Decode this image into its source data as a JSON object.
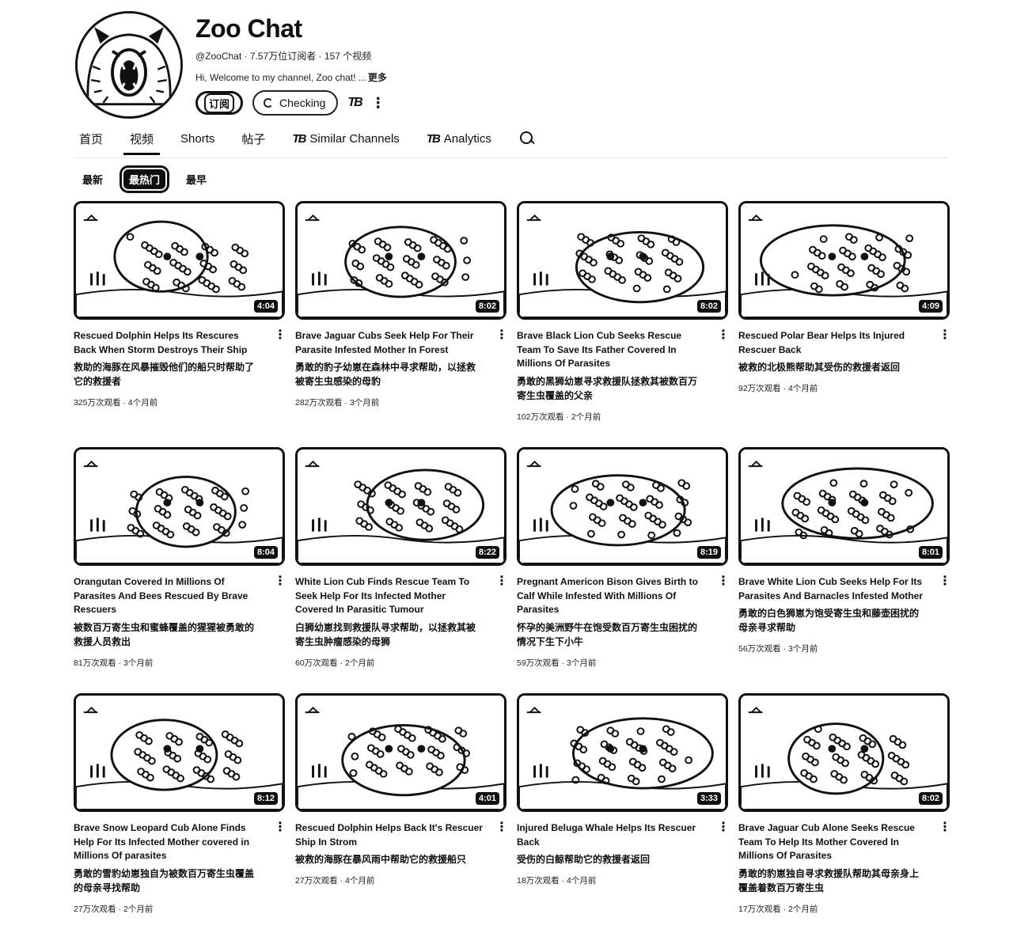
{
  "channel": {
    "name": "Zoo Chat",
    "handle_line": "@ZooChat · 7.57万位订阅者 · 157 个视频",
    "description": "Hi, Welcome to my channel, Zoo chat! ...",
    "more_label": "更多",
    "avatar_icon": "bear-roaring-avatar",
    "subscribe_label": "订阅",
    "checking_label": "Checking",
    "extension_icon": "tubebuddy-icon",
    "extension_label": "TB",
    "menu_icon": "more-vert-icon"
  },
  "tabs": [
    {
      "label": "首页",
      "active": false
    },
    {
      "label": "视频",
      "active": true
    },
    {
      "label": "Shorts",
      "active": false
    },
    {
      "label": "帖子",
      "active": false
    },
    {
      "label": "Similar Channels",
      "active": false,
      "prefix": "TB"
    },
    {
      "label": "Analytics",
      "active": false,
      "prefix": "TB"
    }
  ],
  "search_icon": "search-icon",
  "sort_chips": [
    {
      "label": "最新",
      "active": false
    },
    {
      "label": "最热门",
      "active": true
    },
    {
      "label": "最早",
      "active": false
    }
  ],
  "videos": [
    {
      "title": "Rescued Dolphin Helps Its Rescures Back When Storm Destroys Their Ship",
      "title_cn": "救助的海豚在风暴摧毁他们的船只时帮助了它的救援者",
      "meta": "325万次观看 · 4个月前",
      "duration": "4:04",
      "thumb_icon": "dolphin-helicopter-thumbnail"
    },
    {
      "title": "Brave Jaguar Cubs Seek Help For Their Parasite Infested Mother In Forest",
      "title_cn": "勇敢的豹子幼崽在森林中寻求帮助，以拯救被寄生虫感染的母豹",
      "meta": "282万次观看 · 3个月前",
      "duration": "8:02",
      "thumb_icon": "jaguar-face-thumbnail"
    },
    {
      "title": "Brave Black Lion Cub Seeks Rescue Team To Save Its Father Covered In Millions Of Parasites",
      "title_cn": "勇敢的黑狮幼崽寻求救援队拯救其被数百万寄生虫覆盖的父亲",
      "meta": "102万次观看 · 2个月前",
      "duration": "8:02",
      "thumb_icon": "lion-parasites-thumbnail"
    },
    {
      "title": "Rescued Polar Bear Helps Its Injured Rescuer Back",
      "title_cn": "被救的北极熊帮助其受伤的救援者返回",
      "meta": "92万次观看 · 4个月前",
      "duration": "4:09",
      "thumb_icon": "polar-bear-thumbnail"
    },
    {
      "title": "Orangutan Covered In Millions Of Parasites And Bees Rescued By Brave Rescuers",
      "title_cn": "被数百万寄生虫和蜜蜂覆盖的猩猩被勇敢的救援人员救出",
      "meta": "81万次观看 · 3个月前",
      "duration": "8:04",
      "thumb_icon": "orangutan-thumbnail"
    },
    {
      "title": "White Lion Cub Finds Rescue Team To Seek Help For Its Infected Mother Covered In Parasitic Tumour",
      "title_cn": "白狮幼崽找到救援队寻求帮助，以拯救其被寄生虫肿瘤感染的母狮",
      "meta": "60万次观看 · 2个月前",
      "duration": "8:22",
      "thumb_icon": "white-lion-tumour-thumbnail"
    },
    {
      "title": "Pregnant Americon Bison Gives Birth to Calf While Infested With Millions Of Parasites",
      "title_cn": "怀孕的美洲野牛在饱受数百万寄生虫困扰的情况下生下小牛",
      "meta": "59万次观看 · 3个月前",
      "duration": "8:19",
      "thumb_icon": "bison-thumbnail"
    },
    {
      "title": "Brave White Lion Cub Seeks Help For Its Parasites And Barnacles Infested Mother",
      "title_cn": "勇敢的白色狮崽为饱受寄生虫和藤壶困扰的母亲寻求帮助",
      "meta": "56万次观看 · 3个月前",
      "duration": "8:01",
      "thumb_icon": "lion-barnacles-thumbnail"
    },
    {
      "title": "Brave Snow Leopard Cub Alone Finds Help For Its Infected Mother covered in Millions Of parasites",
      "title_cn": "勇敢的雪豹幼崽独自为被数百万寄生虫覆盖的母亲寻找帮助",
      "meta": "27万次观看 · 2个月前",
      "duration": "8:12",
      "thumb_icon": "snow-leopard-thumbnail"
    },
    {
      "title": "Rescued Dolphin Helps Back It's Rescuer Ship In Strom",
      "title_cn": "被救的海豚在暴风雨中帮助它的救援船只",
      "meta": "27万次观看 · 4个月前",
      "duration": "4:01",
      "thumb_icon": "dolphin-ship-thumbnail"
    },
    {
      "title": "Injured Beluga Whale Helps Its Rescuer Back",
      "title_cn": "受伤的白鲸帮助它的救援者返回",
      "meta": "18万次观看 · 4个月前",
      "duration": "3:33",
      "thumb_icon": "beluga-thumbnail"
    },
    {
      "title": "Brave Jaguar Cub Alone Seeks Rescue Team To Help Its Mother Covered In Millions Of Parasites",
      "title_cn": "勇敢的豹崽独自寻求救援队帮助其母亲身上覆盖着数百万寄生虫",
      "meta": "17万次观看 · 2个月前",
      "duration": "8:02",
      "thumb_icon": "jaguar-parasites-thumbnail"
    }
  ],
  "video_menu_icon": "more-vert-icon"
}
